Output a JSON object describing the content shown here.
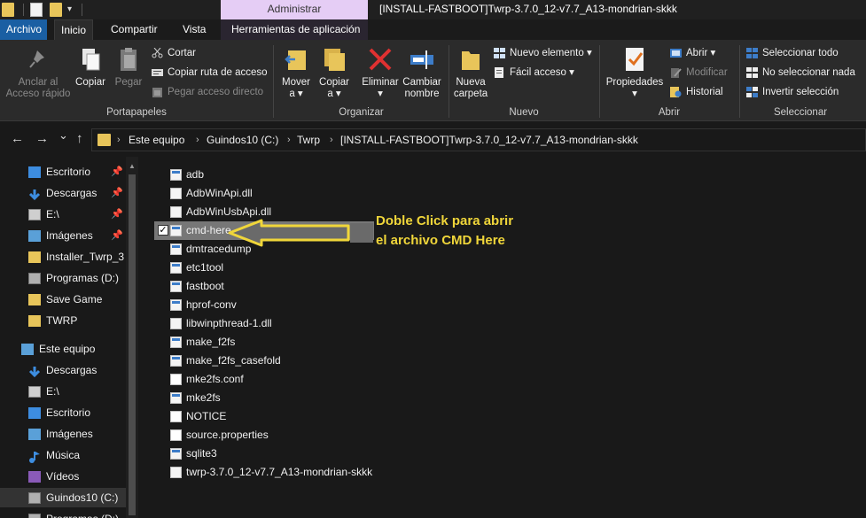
{
  "titlebar": {
    "context_tab": "Administrar",
    "window_title": "[INSTALL-FASTBOOT]Twrp-3.7.0_12-v7.7_A13-mondrian-skkk"
  },
  "tabs": {
    "archivo": "Archivo",
    "inicio": "Inicio",
    "compartir": "Compartir",
    "vista": "Vista",
    "herramientas": "Herramientas de aplicación"
  },
  "ribbon": {
    "portapapeles": {
      "label": "Portapapeles",
      "anclar_line1": "Anclar al",
      "anclar_line2": "Acceso rápido",
      "copiar": "Copiar",
      "pegar": "Pegar",
      "cortar": "Cortar",
      "copiar_ruta": "Copiar ruta de acceso",
      "pegar_acceso": "Pegar acceso directo"
    },
    "organizar": {
      "label": "Organizar",
      "mover_line1": "Mover",
      "mover_line2": "a ▾",
      "copiar_line1": "Copiar",
      "copiar_line2": "a ▾",
      "eliminar_line1": "Eliminar",
      "eliminar_line2": "▾",
      "cambiar_line1": "Cambiar",
      "cambiar_line2": "nombre"
    },
    "nuevo": {
      "label": "Nuevo",
      "carpeta_line1": "Nueva",
      "carpeta_line2": "carpeta",
      "nuevo_elemento": "Nuevo elemento ▾",
      "facil_acceso": "Fácil acceso ▾"
    },
    "abrir": {
      "label": "Abrir",
      "propiedades_line1": "Propiedades",
      "propiedades_line2": "▾",
      "abrir": "Abrir ▾",
      "modificar": "Modificar",
      "historial": "Historial"
    },
    "seleccionar": {
      "label": "Seleccionar",
      "todo": "Seleccionar todo",
      "nada": "No seleccionar nada",
      "invertir": "Invertir selección"
    }
  },
  "nav": {
    "back": "←",
    "forward": "→",
    "recent": "⌄",
    "up": "↑",
    "breadcrumbs": [
      "Este equipo",
      "Guindos10 (C:)",
      "Twrp",
      "[INSTALL-FASTBOOT]Twrp-3.7.0_12-v7.7_A13-mondrian-skkk"
    ]
  },
  "sidebar": {
    "quick_access": [
      {
        "label": "Escritorio",
        "pinned": true
      },
      {
        "label": "Descargas",
        "pinned": true
      },
      {
        "label": "E:\\",
        "pinned": true
      },
      {
        "label": "Imágenes",
        "pinned": true
      },
      {
        "label": "Installer_Twrp_3"
      },
      {
        "label": "Programas (D:)"
      },
      {
        "label": "Save Game"
      },
      {
        "label": "TWRP"
      }
    ],
    "this_pc": {
      "label": "Este equipo",
      "items": [
        "Descargas",
        "E:\\",
        "Escritorio",
        "Imágenes",
        "Música",
        "Vídeos",
        "Guindos10 (C:)",
        "Programas (D:)"
      ]
    }
  },
  "files": [
    {
      "name": "adb",
      "type": "exe"
    },
    {
      "name": "AdbWinApi.dll",
      "type": "dll"
    },
    {
      "name": "AdbWinUsbApi.dll",
      "type": "dll"
    },
    {
      "name": "cmd-here",
      "type": "exe",
      "selected": true
    },
    {
      "name": "dmtracedump",
      "type": "exe"
    },
    {
      "name": "etc1tool",
      "type": "exe"
    },
    {
      "name": "fastboot",
      "type": "exe"
    },
    {
      "name": "hprof-conv",
      "type": "exe"
    },
    {
      "name": "libwinpthread-1.dll",
      "type": "dll"
    },
    {
      "name": "make_f2fs",
      "type": "exe"
    },
    {
      "name": "make_f2fs_casefold",
      "type": "exe"
    },
    {
      "name": "mke2fs.conf",
      "type": "doc"
    },
    {
      "name": "mke2fs",
      "type": "exe"
    },
    {
      "name": "NOTICE",
      "type": "doc"
    },
    {
      "name": "source.properties",
      "type": "doc"
    },
    {
      "name": "sqlite3",
      "type": "exe"
    },
    {
      "name": "twrp-3.7.0_12-v7.7_A13-mondrian-skkk",
      "type": "dll"
    }
  ],
  "annotation": {
    "line1": "Doble Click para abrir",
    "line2": "el archivo CMD Here",
    "color": "#f0d63a"
  },
  "colors": {
    "accent_tab": "#1a5fa3",
    "selection": "#777777",
    "folder": "#e8c55a"
  }
}
